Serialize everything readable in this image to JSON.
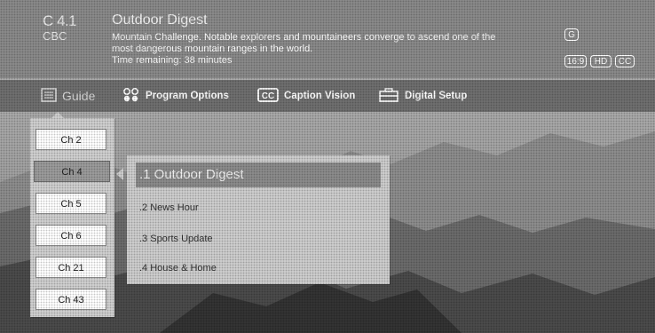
{
  "banner": {
    "channel_number": "C 4.1",
    "channel_network": "CBC",
    "program_title": "Outdoor Digest",
    "description": "Mountain Challenge. Notable explorers and mountaineers converge to ascend one of the most dangerous mountain ranges in the world.",
    "time_remaining": "Time remaining: 38 minutes",
    "rating_badge": "G",
    "aspect_badge": "16:9",
    "hd_badge": "HD",
    "cc_badge": "CC"
  },
  "menu": {
    "guide_label": "Guide",
    "program_options_label": "Program Options",
    "caption_vision_label": "Caption Vision",
    "digital_setup_label": "Digital Setup",
    "caption_icon_text": "CC"
  },
  "channels": [
    {
      "label": "Ch 2"
    },
    {
      "label": "Ch 4",
      "selected": true
    },
    {
      "label": "Ch 5"
    },
    {
      "label": "Ch 6"
    },
    {
      "label": "Ch 21"
    },
    {
      "label": "Ch 43"
    }
  ],
  "programs": [
    {
      "label": ".1 Outdoor Digest",
      "selected": true
    },
    {
      "label": ".2 News Hour"
    },
    {
      "label": ".3 Sports Update"
    },
    {
      "label": ".4 House & Home"
    }
  ],
  "icons": {
    "guide": "list-icon",
    "program_options": "dots-icon",
    "caption_vision": "cc-icon",
    "digital_setup": "toolbox-icon"
  },
  "colors": {
    "banner_bg": "#8a8a8a",
    "menubar_bg": "#6f6f6f",
    "panel_bg": "#cdcdcd",
    "highlight": "#8b8b8b"
  }
}
